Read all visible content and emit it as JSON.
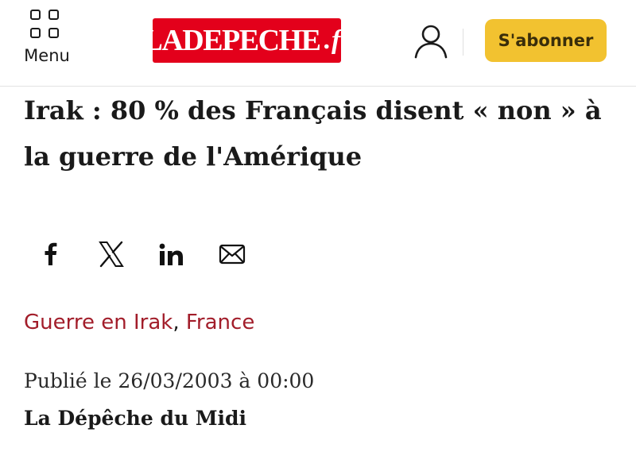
{
  "header": {
    "menu_label": "Menu",
    "logo": {
      "main": "LADEPECHE",
      "dot": ".",
      "suffix": "fr"
    },
    "subscribe_label": "S'abonner",
    "colors": {
      "logo_red": "#e3001b",
      "subscribe_yellow": "#f2c230"
    }
  },
  "article": {
    "title": "Irak : 80 % des Français disent « non » à la guerre de l'Amérique",
    "share": {
      "icons": [
        "facebook-icon",
        "x-icon",
        "linkedin-icon",
        "email-icon"
      ]
    },
    "tags": [
      {
        "label": "Guerre en Irak"
      },
      {
        "label": "France"
      }
    ],
    "tag_separator": ",",
    "published": "Publié le 26/03/2003 à 00:00",
    "author": "La Dépêche du Midi",
    "colors": {
      "tag_red": "#a21d2a"
    }
  }
}
